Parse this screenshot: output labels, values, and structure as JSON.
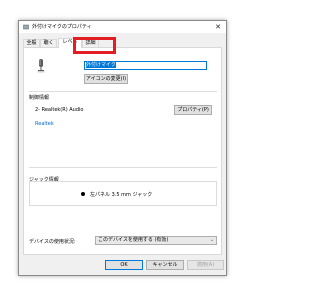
{
  "window": {
    "title": "外付けマイクのプロパティ",
    "close_glyph": "✕"
  },
  "tabs": [
    {
      "label": "全般",
      "active": false
    },
    {
      "label": "聴く",
      "active": false
    },
    {
      "label": "レベル",
      "active": true
    },
    {
      "label": "詳細",
      "active": false
    }
  ],
  "general": {
    "device_name": "外付けマイク",
    "change_icon_label": "アイコンの変更(I)"
  },
  "controller": {
    "label": "制御情報",
    "device": "2- Realtek(R) Audio",
    "vendor_link": "Realtek",
    "properties_label": "プロパティ(P)"
  },
  "jack": {
    "label": "ジャック情報",
    "item": "左パネル 3.5 mm ジャック"
  },
  "usage": {
    "label": "デバイスの使用状況:",
    "value": "このデバイスを使用する (有効)"
  },
  "buttons": {
    "ok": "OK",
    "cancel": "キャンセル",
    "apply": "適用(A)"
  },
  "colors": {
    "highlight": "#e21d24",
    "accent": "#0078d7",
    "link": "#0066cc"
  }
}
